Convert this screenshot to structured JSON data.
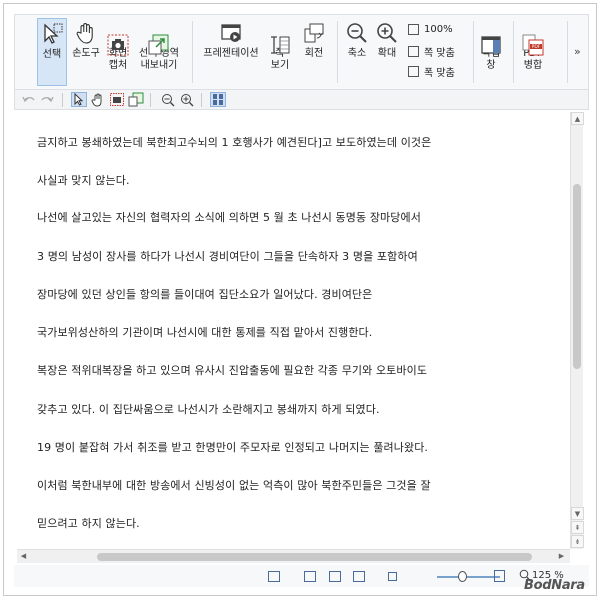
{
  "ribbon": {
    "buttons": [
      {
        "label": "선택",
        "icon": "cursor-icon"
      },
      {
        "label": "손도구",
        "icon": "hand-icon"
      },
      {
        "label": "화면\n캡처",
        "icon": "camera-icon"
      },
      {
        "label": "선택 영역\n내보내기",
        "icon": "export-area-icon"
      },
      {
        "label": "프레젠테이션",
        "icon": "presentation-icon"
      },
      {
        "label": "쪽\n보기",
        "icon": "page-view-icon"
      },
      {
        "label": "회전",
        "icon": "rotate-icon"
      },
      {
        "label": "축소",
        "icon": "zoom-out-icon"
      },
      {
        "label": "확대",
        "icon": "zoom-in-icon"
      },
      {
        "label": "작업\n창",
        "icon": "task-pane-icon"
      },
      {
        "label": "PDF\n병합",
        "icon": "pdf-merge-icon"
      }
    ],
    "zoom_options": [
      "100%",
      "쪽 맞춤",
      "폭 맞춤"
    ],
    "more": "»"
  },
  "document": {
    "lines": [
      "금지하고  봉쇄하였는데  북한최고수뇌의  1  호행사가  예견된다]고  보도하였는데  이것은",
      "사실과 맞지 않는다.",
      "나선에  살고있는  자신의  협력자의  소식에  의하면  5  월  초  나선시  동명동  장마당에서",
      "3  명의  남성이  장사를  하다가  나선시  경비여단이  그들을  단속하자  3  명을  포함하여",
      "장마당에      있던      상인들      항의를      들이대여      집단소요가      일어났다. 경비여단은",
      "국가보위성산하의 기관이며 나선시에 대한 통제를 직접 맡아서 진행한다.",
      "복장은  적위대복장을  하고  있으며   유사시  진압출동에  필요한  각종  무기와  오토바이도",
      "갖추고 있다. 이 집단싸움으로 나선시가 소란해지고 봉쇄까지 하게 되였다.",
      "19 명이 붙잡혀 가서 취조를 받고 한명만이 주모자로 인정되고 나머지는 풀려나왔다.",
      "이처럼  북한내부에  대한  방송에서  신빙성이  없는  억측이  많아  북한주민들은  그것을  잘",
      "믿으려고  하지  않는다."
    ]
  },
  "status": {
    "zoom": "125 %",
    "zoom_fraction": 0.4
  },
  "watermark": "BodNara"
}
